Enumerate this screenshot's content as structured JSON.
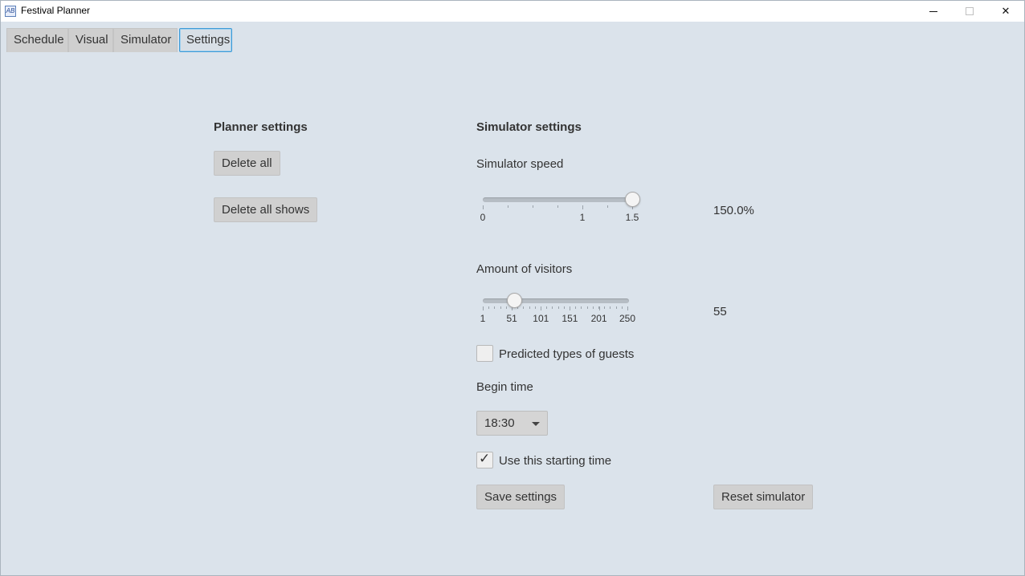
{
  "window": {
    "title": "Festival Planner",
    "icon_text": "AB"
  },
  "tabs": [
    {
      "label": "Schedule",
      "selected": false
    },
    {
      "label": "Visual",
      "selected": false
    },
    {
      "label": "Simulator",
      "selected": false
    },
    {
      "label": "Settings",
      "selected": true
    }
  ],
  "planner": {
    "title": "Planner settings",
    "delete_all_label": "Delete all",
    "delete_all_shows_label": "Delete all shows"
  },
  "simulator": {
    "title": "Simulator settings",
    "speed": {
      "label": "Simulator speed",
      "min": 0,
      "max": 1.5,
      "value": 1.5,
      "tick_labels": [
        "0",
        "1",
        "1.5"
      ],
      "tick_values": [
        0,
        1,
        1.5
      ],
      "display": "150.0%"
    },
    "visitors": {
      "label": "Amount of visitors",
      "min": 1,
      "max": 250,
      "value": 55,
      "tick_labels": [
        "1",
        "51",
        "101",
        "151",
        "201",
        "250"
      ],
      "tick_values": [
        1,
        51,
        101,
        151,
        201,
        250
      ],
      "display": "55"
    },
    "predicted_guests": {
      "label": "Predicted types of guests",
      "checked": false
    },
    "begin_time": {
      "label": "Begin time",
      "value": "18:30"
    },
    "use_starting_time": {
      "label": "Use this starting time",
      "checked": true,
      "check_glyph": "✓"
    },
    "save_label": "Save settings",
    "reset_label": "Reset simulator"
  }
}
